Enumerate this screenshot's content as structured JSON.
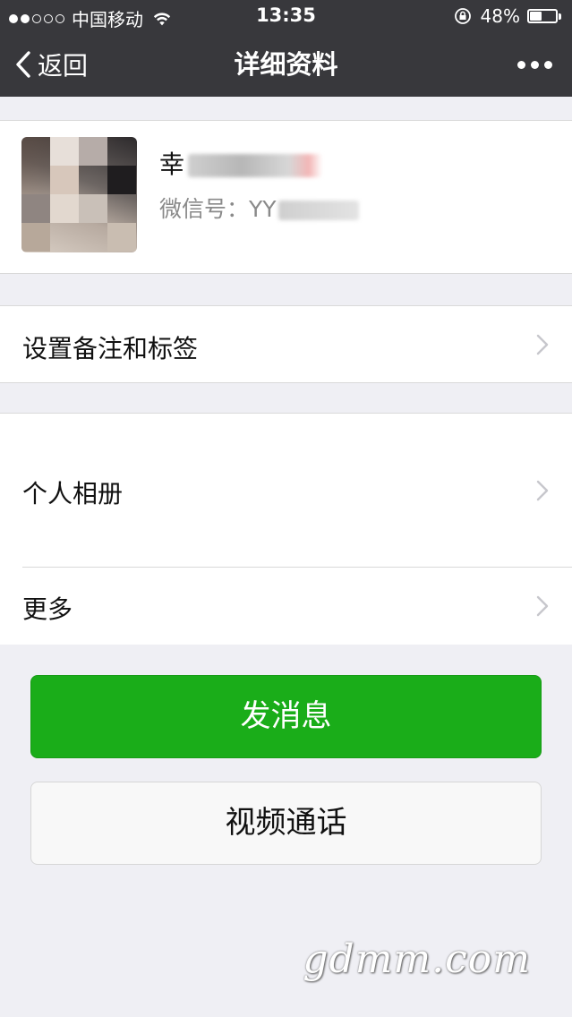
{
  "status_bar": {
    "carrier": "中国移动",
    "time": "13:35",
    "battery_percent": "48%",
    "battery_level": 0.48,
    "signal_strength_dots_filled": 2,
    "signal_strength_dots_total": 5
  },
  "nav": {
    "back_label": "返回",
    "title": "详细资料"
  },
  "profile": {
    "name_visible_char": "幸",
    "wechat_id_label": "微信号：",
    "wechat_id_visible": "YY"
  },
  "cells": {
    "remark_tags": "设置备注和标签",
    "album": "个人相册",
    "more": "更多"
  },
  "buttons": {
    "send_message": "发消息",
    "video_call": "视频通话"
  },
  "watermark": "gdmm.com",
  "colors": {
    "nav_background": "#38383c",
    "page_background": "#efeff4",
    "primary_green": "#1aad19",
    "secondary_button": "#f8f8f8",
    "secondary_text": "#8a8a8a"
  }
}
